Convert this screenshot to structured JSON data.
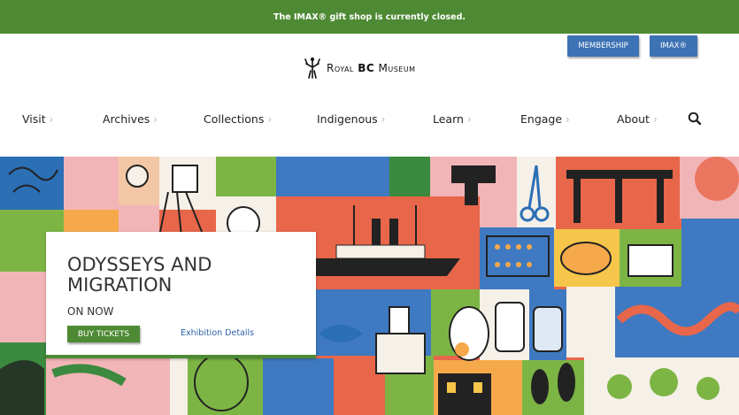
{
  "banner": {
    "text": "The IMAX® gift shop is currently closed."
  },
  "header": {
    "membership_label": "MEMBERSHIP",
    "imax_label": "IMAX®",
    "logo_prefix": "Royal ",
    "logo_bold": "BC",
    "logo_suffix": " Museum"
  },
  "nav": {
    "items": [
      {
        "label": "Visit"
      },
      {
        "label": "Archives"
      },
      {
        "label": "Collections"
      },
      {
        "label": "Indigenous"
      },
      {
        "label": "Learn"
      },
      {
        "label": "Engage"
      },
      {
        "label": "About"
      }
    ],
    "search_icon": "search-icon"
  },
  "hero": {
    "title": "ODYSSEYS AND MIGRATION",
    "status": "ON NOW",
    "tickets_label": "BUY TICKETS",
    "details_label": "Exhibition Details"
  },
  "colors": {
    "banner": "#4e8a34",
    "button_blue": "#3d72b4",
    "link_blue": "#2e62a8",
    "hero_orange": "#e8664a"
  }
}
